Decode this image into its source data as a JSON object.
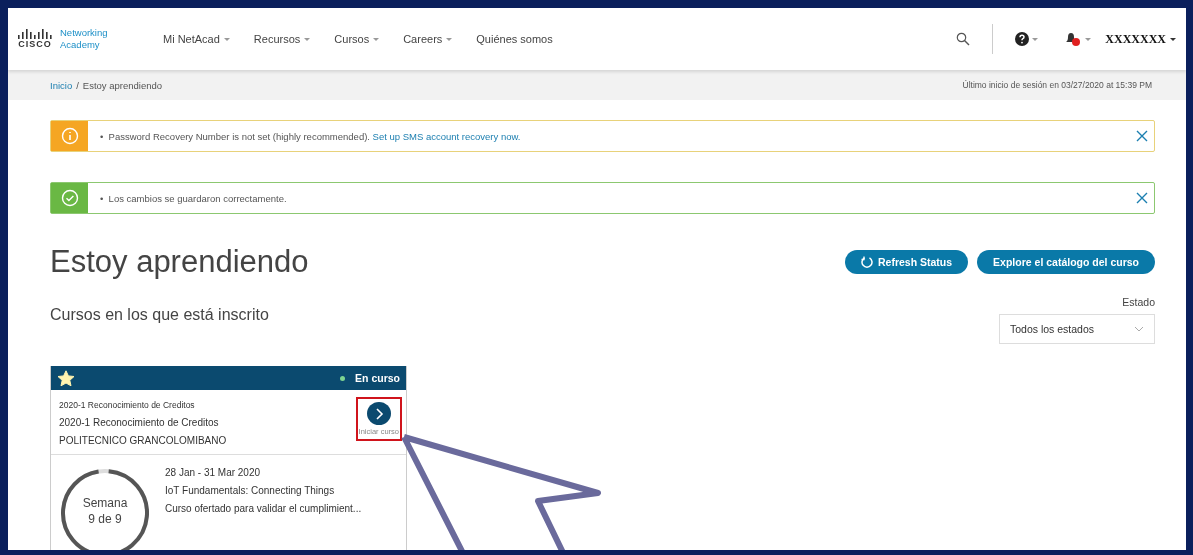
{
  "header": {
    "logo": {
      "brand": "CISCO",
      "line1": "Networking",
      "line2": "Academy"
    },
    "nav": [
      {
        "label": "Mi NetAcad",
        "dropdown": true
      },
      {
        "label": "Recursos",
        "dropdown": true
      },
      {
        "label": "Cursos",
        "dropdown": true
      },
      {
        "label": "Careers",
        "dropdown": true
      },
      {
        "label": "Quiénes somos",
        "dropdown": false
      }
    ],
    "user": {
      "name": "XXXXXXX",
      "notification": true
    }
  },
  "breadcrumb": {
    "items": [
      {
        "label": "Inicio",
        "link": true
      },
      {
        "label": "Estoy aprendiendo",
        "link": false
      }
    ],
    "separator": "/",
    "last_login": "Último inicio de sesión en 03/27/2020 at 15:39 PM"
  },
  "alerts": [
    {
      "kind": "warning",
      "bullet": "•",
      "text": "Password Recovery Number is not set (highly recommended).",
      "link": "Set up SMS account recovery now."
    },
    {
      "kind": "success",
      "bullet": "•",
      "text": "Los cambios se guardaron correctamente."
    }
  ],
  "page_title": "Estoy aprendiendo",
  "buttons": [
    {
      "label": "Refresh Status",
      "kind": "refresh"
    },
    {
      "label": "Explore el catálogo del curso",
      "kind": "plain"
    }
  ],
  "section_title": "Cursos en los que está inscrito",
  "filter": {
    "label": "Estado",
    "value": "Todos los estados"
  },
  "courses": [
    {
      "starred": true,
      "status": "En curso",
      "code": "2020-1 Reconocimiento de Creditos",
      "name": "2020-1 Reconocimiento de Creditos",
      "institution": "POLITECNICO GRANCOLOMIBANO",
      "start_label": "Iniciar curso",
      "highlighted": true,
      "dates": "28 Jan - 31 Mar 2020",
      "title": "IoT Fundamentals: Connecting Things",
      "description": "Curso ofertado para validar el cumplimient...",
      "week_label": "Semana",
      "week_count": "9 de 9",
      "level": 0.96
    }
  ]
}
